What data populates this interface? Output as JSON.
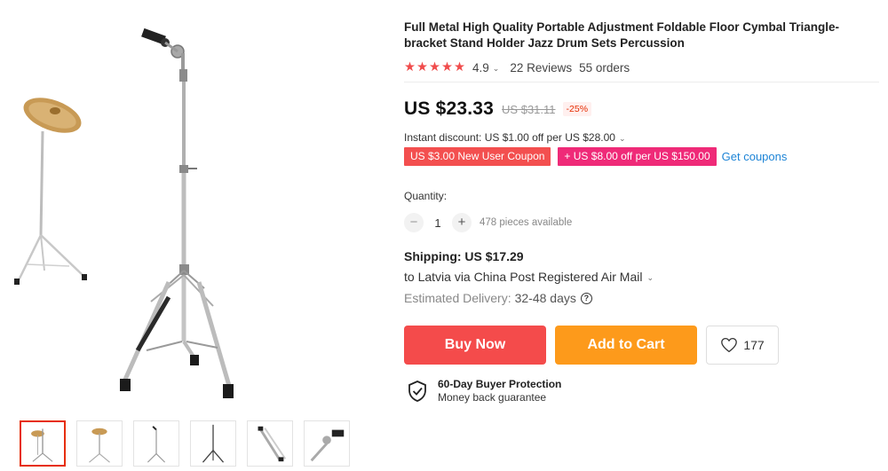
{
  "product": {
    "title": "Full Metal High Quality Portable Adjustment Foldable Floor Cymbal Triangle-bracket Stand Holder Jazz Drum Sets Percussion",
    "rating": "4.9",
    "rating_stars": 5,
    "reviews": "22 Reviews",
    "orders": "55 orders"
  },
  "price": {
    "current": "US $23.33",
    "original": "US $31.11",
    "discount": "-25%"
  },
  "promo": {
    "instant_discount": "Instant discount: US $1.00 off per US $28.00",
    "new_user_coupon": "US $3.00 New User Coupon",
    "store_coupon": "+ US $8.00 off per US $150.00",
    "get_coupons": "Get coupons"
  },
  "quantity": {
    "label": "Quantity:",
    "value": "1",
    "minus": "−",
    "plus": "+",
    "available": "478 pieces available"
  },
  "shipping": {
    "title": "Shipping: US $17.29",
    "via": "to Latvia via China Post Registered Air Mail",
    "delivery_label": "Estimated Delivery:",
    "delivery_value": "32-48 days",
    "help": "?"
  },
  "actions": {
    "buy_now": "Buy Now",
    "add_to_cart": "Add to Cart",
    "wishlist_count": "177"
  },
  "protection": {
    "title": "60-Day Buyer Protection",
    "subtitle": "Money back guarantee"
  },
  "gallery": {
    "thumbnail_count": 6,
    "active_thumbnail": 0
  },
  "colors": {
    "buy_now": "#f44b4b",
    "add_to_cart": "#fd9a1b",
    "star": "#f04c4c",
    "link": "#1d84d6",
    "new_user_coupon": "#f34f4f",
    "store_coupon": "#ef2a78",
    "active_thumb_border": "#e62e04"
  },
  "icons": {
    "star": "star-icon",
    "caret": "chevron-down-icon",
    "help": "help-circle-icon",
    "heart": "heart-icon",
    "shield": "shield-check-icon"
  }
}
